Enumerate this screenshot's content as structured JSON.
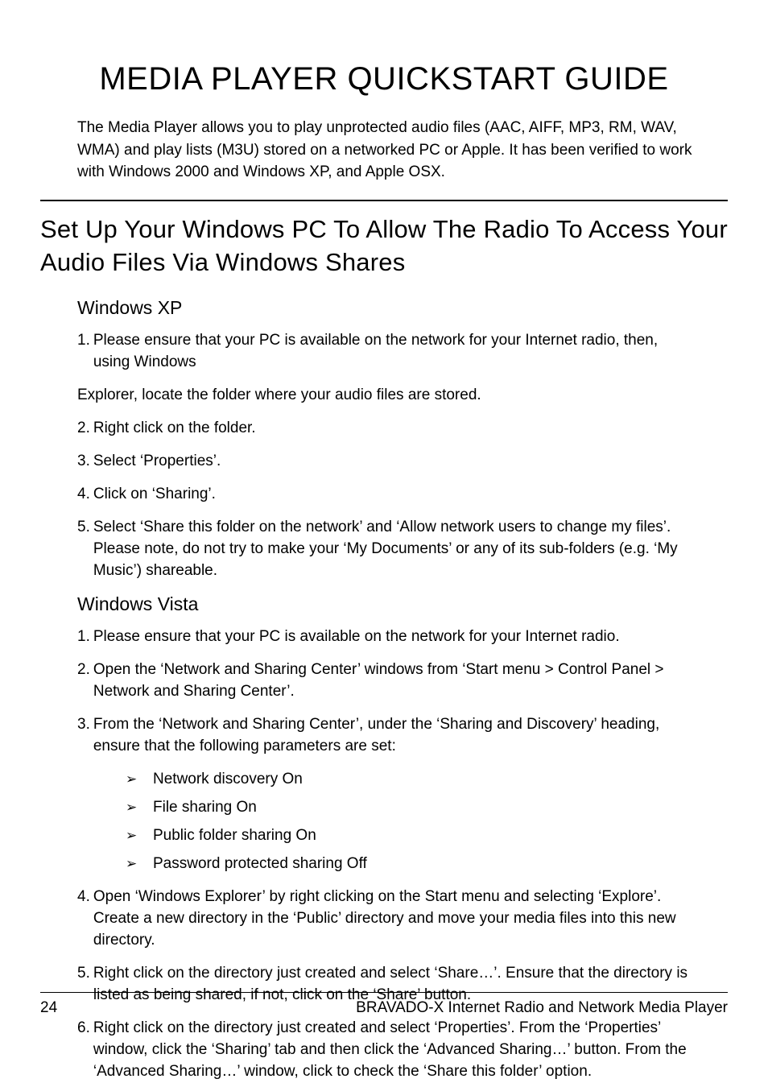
{
  "title": "MEDIA PLAYER QUICKSTART GUIDE",
  "intro": "The Media Player allows you to play unprotected audio files (AAC, AIFF, MP3, RM, WAV, WMA) and play lists (M3U) stored on a networked PC or Apple. It has been verified to work with Windows 2000 and Windows XP, and Apple OSX.",
  "section_heading": "Set Up Your Windows PC To Allow The Radio To Access Your Audio Files Via Windows Shares",
  "xp": {
    "heading": "Windows XP",
    "steps": [
      "Please ensure that your PC is available on the network for your Internet radio, then, using Windows",
      "Right click on the folder.",
      "Select ‘Properties’.",
      "Click on ‘Sharing’.",
      "Select ‘Share this folder on the network’ and ‘Allow network users to change my files’. Please note, do not try to make your ‘My Documents’ or any of its sub-folders (e.g. ‘My Music’) shareable."
    ],
    "explorer_line": "Explorer, locate the folder where your audio files are stored."
  },
  "vista": {
    "heading": "Windows Vista",
    "steps": [
      "Please ensure that your PC is available on the network for your Internet radio.",
      "Open the ‘Network and Sharing Center’ windows from ‘Start menu > Control Panel > Network and Sharing Center’.",
      "From the ‘Network and Sharing Center’, under the ‘Sharing and Discovery’ heading, ensure that the following parameters are set:",
      "Open ‘Windows Explorer’ by right clicking on the Start menu and selecting ‘Explore’. Create a new directory in the ‘Public’ directory and move your media files into this new directory.",
      "Right click on the directory just created and select ‘Share…’. Ensure that the directory is listed as being shared, if not, click on the ‘Share’ button.",
      "Right click on the directory just created and select ‘Properties’. From the ‘Properties’ window, click the ‘Sharing’ tab and then click the ‘Advanced Sharing…’ button. From the ‘Advanced Sharing…’ window, click to check the ‘Share this folder’ option."
    ],
    "bullets": [
      "Network discovery On",
      "File sharing On",
      "Public folder sharing On",
      "Password protected sharing Off"
    ]
  },
  "footer": {
    "page": "24",
    "product": "BRAVADO-X Internet Radio and Network Media Player"
  }
}
